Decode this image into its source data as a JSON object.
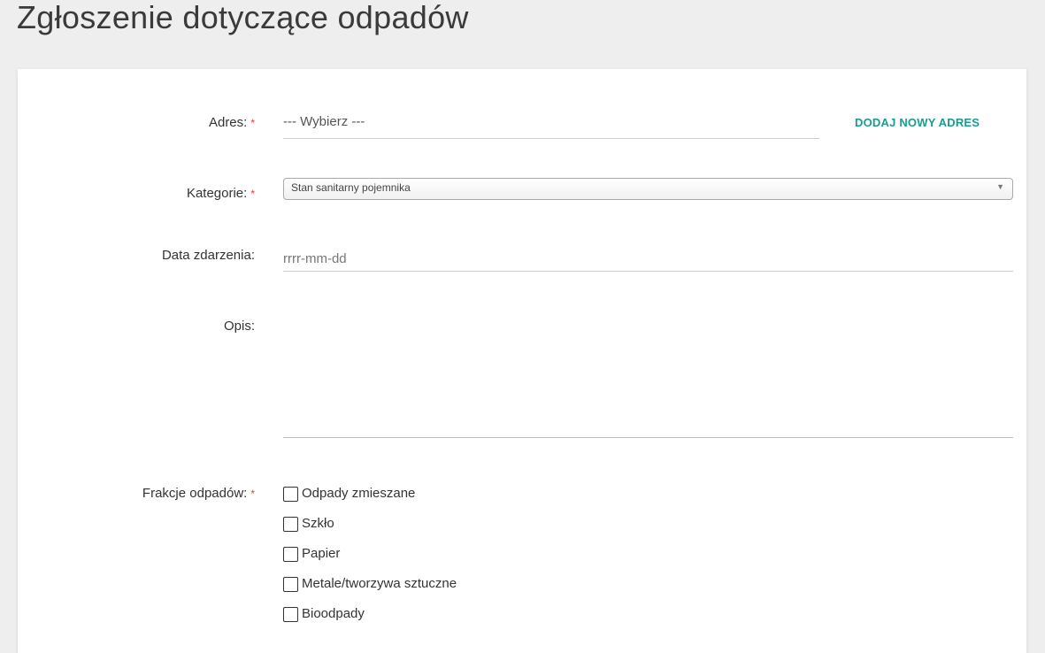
{
  "page": {
    "title": "Zgłoszenie dotyczące odpadów"
  },
  "form": {
    "address": {
      "label": "Adres:",
      "required_mark": "*",
      "value": "--- Wybierz ---",
      "add_button_label": "DODAJ NOWY ADRES"
    },
    "category": {
      "label": "Kategorie:",
      "required_mark": "*",
      "value": "Stan sanitarny pojemnika",
      "arrow": "▼"
    },
    "date": {
      "label": "Data zdarzenia:",
      "placeholder": "rrrr-mm-dd",
      "value": ""
    },
    "description": {
      "label": "Opis:",
      "value": ""
    },
    "fractions": {
      "label": "Frakcje odpadów:",
      "required_mark": "*",
      "options": [
        {
          "label": "Odpady zmieszane",
          "checked": false
        },
        {
          "label": "Szkło",
          "checked": false
        },
        {
          "label": "Papier",
          "checked": false
        },
        {
          "label": "Metale/tworzywa sztuczne",
          "checked": false
        },
        {
          "label": "Bioodpady",
          "checked": false
        }
      ]
    }
  },
  "colors": {
    "accent": "#1a9c8c",
    "required": "#e53935",
    "background": "#eeeeee"
  }
}
